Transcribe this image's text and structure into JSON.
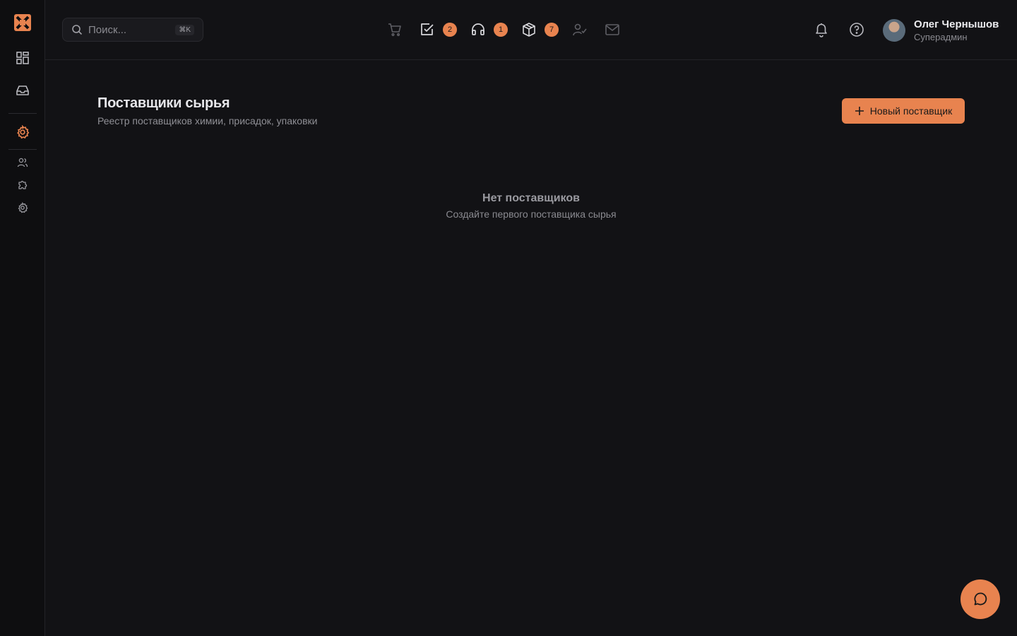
{
  "colors": {
    "accent": "#e8834f",
    "background": "#121215",
    "sidebar": "#0e0e10"
  },
  "sidebar": {
    "items": [
      {
        "name": "logo",
        "icon": "logo-icon"
      },
      {
        "name": "dashboard",
        "icon": "dashboard-icon"
      },
      {
        "name": "inbox",
        "icon": "inbox-icon"
      },
      {
        "name": "settings",
        "icon": "gear-icon",
        "active": true
      },
      {
        "name": "users",
        "icon": "users-icon"
      },
      {
        "name": "integrations",
        "icon": "puzzle-icon"
      },
      {
        "name": "system-settings",
        "icon": "gear-icon"
      }
    ]
  },
  "header": {
    "search": {
      "placeholder": "Поиск...",
      "shortcut": "⌘K"
    },
    "quick_actions": [
      {
        "icon": "cart-icon",
        "badge": null
      },
      {
        "icon": "tasks-icon",
        "badge": "2"
      },
      {
        "icon": "headset-icon",
        "badge": "1"
      },
      {
        "icon": "package-icon",
        "badge": "7"
      },
      {
        "icon": "user-check-icon",
        "badge": null
      },
      {
        "icon": "mail-icon",
        "badge": null
      }
    ],
    "user": {
      "name": "Олег Чернышов",
      "role": "Суперадмин"
    }
  },
  "page": {
    "title": "Поставщики сырья",
    "subtitle": "Реестр поставщиков химии, присадок, упаковки",
    "new_button_label": "Новый поставщик",
    "empty_title": "Нет поставщиков",
    "empty_subtitle": "Создайте первого поставщика сырья"
  }
}
